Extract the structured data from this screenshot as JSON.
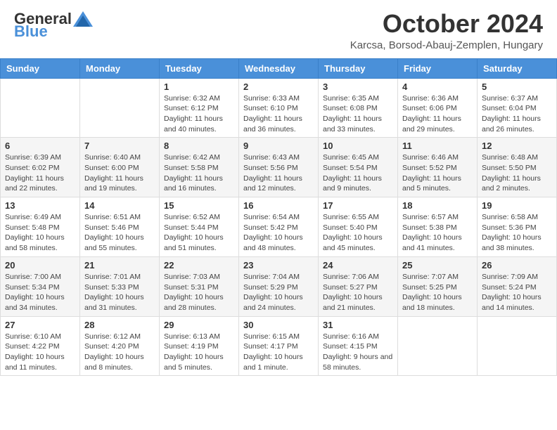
{
  "logo": {
    "general": "General",
    "blue": "Blue"
  },
  "header": {
    "month": "October 2024",
    "location": "Karcsa, Borsod-Abauj-Zemplen, Hungary"
  },
  "weekdays": [
    "Sunday",
    "Monday",
    "Tuesday",
    "Wednesday",
    "Thursday",
    "Friday",
    "Saturday"
  ],
  "weeks": [
    [
      {
        "day": "",
        "info": ""
      },
      {
        "day": "",
        "info": ""
      },
      {
        "day": "1",
        "info": "Sunrise: 6:32 AM\nSunset: 6:12 PM\nDaylight: 11 hours and 40 minutes."
      },
      {
        "day": "2",
        "info": "Sunrise: 6:33 AM\nSunset: 6:10 PM\nDaylight: 11 hours and 36 minutes."
      },
      {
        "day": "3",
        "info": "Sunrise: 6:35 AM\nSunset: 6:08 PM\nDaylight: 11 hours and 33 minutes."
      },
      {
        "day": "4",
        "info": "Sunrise: 6:36 AM\nSunset: 6:06 PM\nDaylight: 11 hours and 29 minutes."
      },
      {
        "day": "5",
        "info": "Sunrise: 6:37 AM\nSunset: 6:04 PM\nDaylight: 11 hours and 26 minutes."
      }
    ],
    [
      {
        "day": "6",
        "info": "Sunrise: 6:39 AM\nSunset: 6:02 PM\nDaylight: 11 hours and 22 minutes."
      },
      {
        "day": "7",
        "info": "Sunrise: 6:40 AM\nSunset: 6:00 PM\nDaylight: 11 hours and 19 minutes."
      },
      {
        "day": "8",
        "info": "Sunrise: 6:42 AM\nSunset: 5:58 PM\nDaylight: 11 hours and 16 minutes."
      },
      {
        "day": "9",
        "info": "Sunrise: 6:43 AM\nSunset: 5:56 PM\nDaylight: 11 hours and 12 minutes."
      },
      {
        "day": "10",
        "info": "Sunrise: 6:45 AM\nSunset: 5:54 PM\nDaylight: 11 hours and 9 minutes."
      },
      {
        "day": "11",
        "info": "Sunrise: 6:46 AM\nSunset: 5:52 PM\nDaylight: 11 hours and 5 minutes."
      },
      {
        "day": "12",
        "info": "Sunrise: 6:48 AM\nSunset: 5:50 PM\nDaylight: 11 hours and 2 minutes."
      }
    ],
    [
      {
        "day": "13",
        "info": "Sunrise: 6:49 AM\nSunset: 5:48 PM\nDaylight: 10 hours and 58 minutes."
      },
      {
        "day": "14",
        "info": "Sunrise: 6:51 AM\nSunset: 5:46 PM\nDaylight: 10 hours and 55 minutes."
      },
      {
        "day": "15",
        "info": "Sunrise: 6:52 AM\nSunset: 5:44 PM\nDaylight: 10 hours and 51 minutes."
      },
      {
        "day": "16",
        "info": "Sunrise: 6:54 AM\nSunset: 5:42 PM\nDaylight: 10 hours and 48 minutes."
      },
      {
        "day": "17",
        "info": "Sunrise: 6:55 AM\nSunset: 5:40 PM\nDaylight: 10 hours and 45 minutes."
      },
      {
        "day": "18",
        "info": "Sunrise: 6:57 AM\nSunset: 5:38 PM\nDaylight: 10 hours and 41 minutes."
      },
      {
        "day": "19",
        "info": "Sunrise: 6:58 AM\nSunset: 5:36 PM\nDaylight: 10 hours and 38 minutes."
      }
    ],
    [
      {
        "day": "20",
        "info": "Sunrise: 7:00 AM\nSunset: 5:34 PM\nDaylight: 10 hours and 34 minutes."
      },
      {
        "day": "21",
        "info": "Sunrise: 7:01 AM\nSunset: 5:33 PM\nDaylight: 10 hours and 31 minutes."
      },
      {
        "day": "22",
        "info": "Sunrise: 7:03 AM\nSunset: 5:31 PM\nDaylight: 10 hours and 28 minutes."
      },
      {
        "day": "23",
        "info": "Sunrise: 7:04 AM\nSunset: 5:29 PM\nDaylight: 10 hours and 24 minutes."
      },
      {
        "day": "24",
        "info": "Sunrise: 7:06 AM\nSunset: 5:27 PM\nDaylight: 10 hours and 21 minutes."
      },
      {
        "day": "25",
        "info": "Sunrise: 7:07 AM\nSunset: 5:25 PM\nDaylight: 10 hours and 18 minutes."
      },
      {
        "day": "26",
        "info": "Sunrise: 7:09 AM\nSunset: 5:24 PM\nDaylight: 10 hours and 14 minutes."
      }
    ],
    [
      {
        "day": "27",
        "info": "Sunrise: 6:10 AM\nSunset: 4:22 PM\nDaylight: 10 hours and 11 minutes."
      },
      {
        "day": "28",
        "info": "Sunrise: 6:12 AM\nSunset: 4:20 PM\nDaylight: 10 hours and 8 minutes."
      },
      {
        "day": "29",
        "info": "Sunrise: 6:13 AM\nSunset: 4:19 PM\nDaylight: 10 hours and 5 minutes."
      },
      {
        "day": "30",
        "info": "Sunrise: 6:15 AM\nSunset: 4:17 PM\nDaylight: 10 hours and 1 minute."
      },
      {
        "day": "31",
        "info": "Sunrise: 6:16 AM\nSunset: 4:15 PM\nDaylight: 9 hours and 58 minutes."
      },
      {
        "day": "",
        "info": ""
      },
      {
        "day": "",
        "info": ""
      }
    ]
  ]
}
